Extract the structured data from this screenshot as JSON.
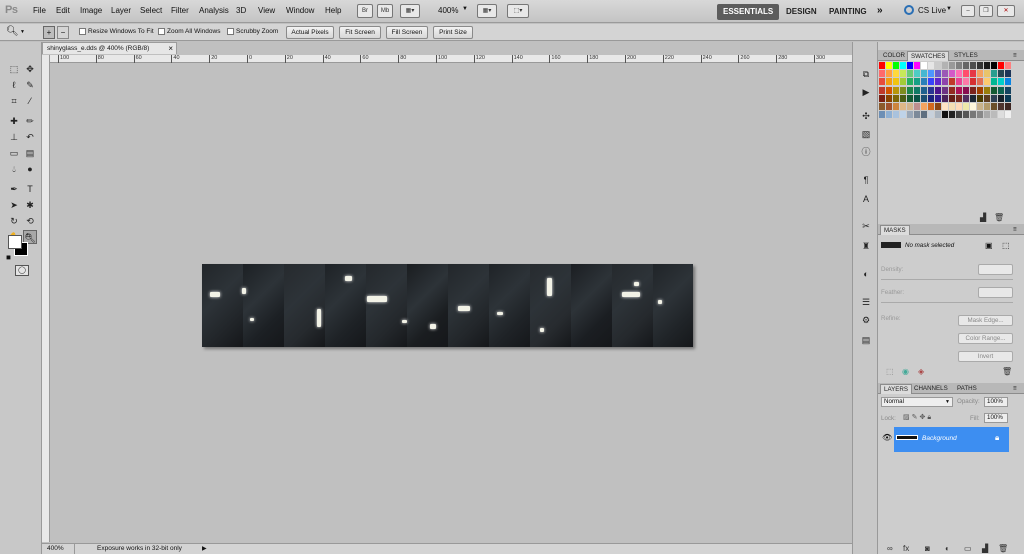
{
  "menubar": {
    "logo": "Ps",
    "items": [
      "File",
      "Edit",
      "Image",
      "Layer",
      "Select",
      "Filter",
      "Analysis",
      "3D",
      "View",
      "Window",
      "Help"
    ],
    "br_icon": "Br",
    "mb_icon": "Mb",
    "zoom": "400%",
    "workspaces": [
      "ESSENTIALS",
      "DESIGN",
      "PAINTING"
    ],
    "more": "»",
    "cslive": "CS Live"
  },
  "options": {
    "resize_windows": "Resize Windows To Fit",
    "zoom_all": "Zoom All Windows",
    "scrubby": "Scrubby Zoom",
    "actual_pixels": "Actual Pixels",
    "fit_screen": "Fit Screen",
    "fill_screen": "Fill Screen",
    "print_size": "Print Size"
  },
  "document": {
    "tab_title": "shinyglass_e.dds @ 400% (RGB/8)",
    "close": "×"
  },
  "ruler": {
    "top_labels": [
      "100",
      "80",
      "60",
      "40",
      "20",
      "0",
      "20",
      "40",
      "60",
      "80",
      "100",
      "120",
      "140",
      "160",
      "180",
      "200",
      "220",
      "240",
      "260",
      "280",
      "300"
    ]
  },
  "status": {
    "zoom": "400%",
    "info": "Exposure works in 32-bit only"
  },
  "panels": {
    "color_tabs": [
      "COLOR",
      "SWATCHES",
      "STYLES"
    ],
    "masks_title": "MASKS",
    "masks_status": "No mask selected",
    "density": "Density:",
    "feather": "Feather:",
    "refine": "Refine:",
    "mask_edge": "Mask Edge...",
    "color_range": "Color Range...",
    "invert": "Invert",
    "layers_tabs": [
      "LAYERS",
      "CHANNELS",
      "PATHS"
    ],
    "blend_mode": "Normal",
    "opacity_label": "Opacity:",
    "opacity_value": "100%",
    "lock_label": "Lock:",
    "fill_label": "Fill:",
    "fill_value": "100%",
    "layer_name": "Background"
  },
  "colors": {
    "accent": "#3d8ef1",
    "menubar": "#c8c8c8",
    "canvas": "#c0c0c0"
  }
}
